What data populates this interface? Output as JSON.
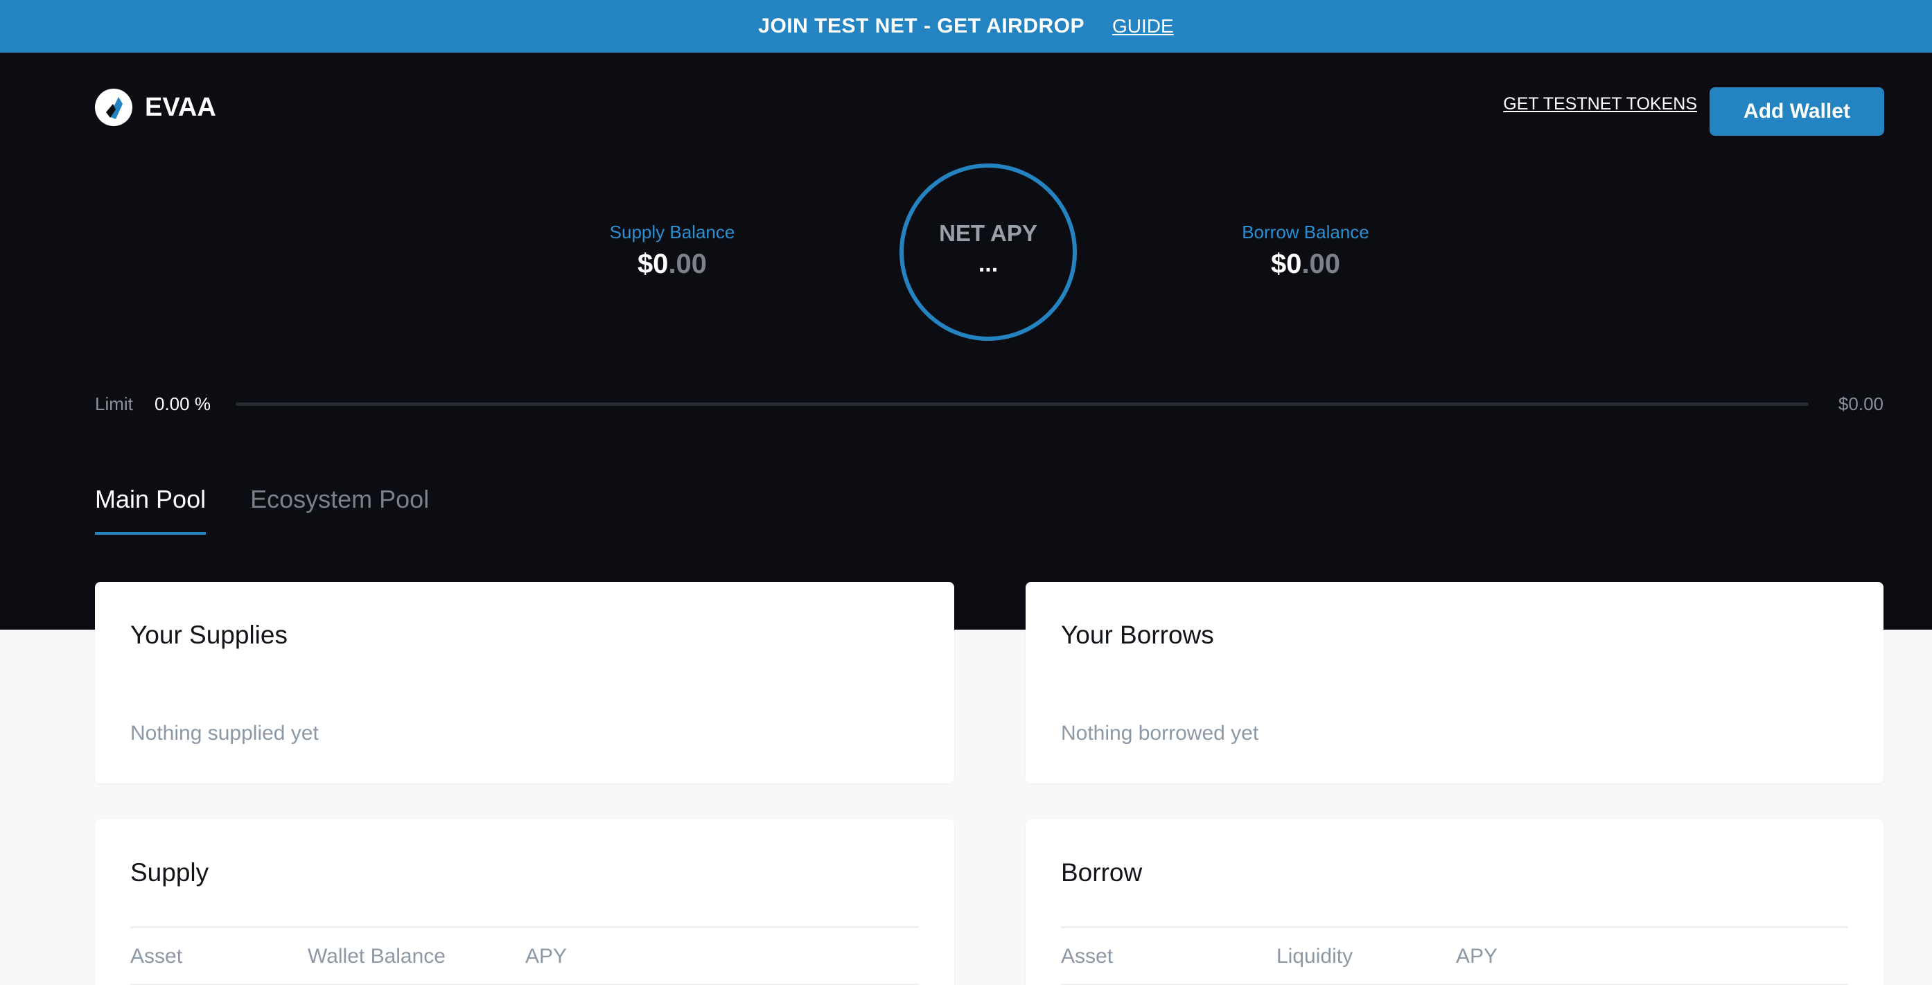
{
  "banner": {
    "title": "JOIN TEST NET - GET AIRDROP",
    "link": "GUIDE"
  },
  "header": {
    "logo_text": "EVAA",
    "testnet_link": "GET TESTNET TOKENS",
    "add_wallet": "Add Wallet"
  },
  "summary": {
    "supply_label": "Supply Balance",
    "supply_whole": "$0",
    "supply_cents": ".00",
    "net_apy_label": "NET APY",
    "net_apy_value": "...",
    "borrow_label": "Borrow Balance",
    "borrow_whole": "$0",
    "borrow_cents": ".00"
  },
  "limit": {
    "label": "Limit",
    "percent": "0.00 %",
    "progress": 0,
    "amount": "$0.00"
  },
  "tabs": [
    {
      "label": "Main Pool",
      "active": true
    },
    {
      "label": "Ecosystem Pool",
      "active": false
    }
  ],
  "your_supplies": {
    "title": "Your Supplies",
    "empty": "Nothing supplied yet"
  },
  "your_borrows": {
    "title": "Your Borrows",
    "empty": "Nothing borrowed yet"
  },
  "supply_table": {
    "title": "Supply",
    "columns": [
      "Asset",
      "Wallet Balance",
      "APY"
    ]
  },
  "borrow_table": {
    "title": "Borrow",
    "columns": [
      "Asset",
      "Liquidity",
      "APY"
    ]
  },
  "colors": {
    "accent": "#2483c1",
    "dark_bg": "#0b0d12",
    "page_bg": "#f7f8fa",
    "muted": "#8c98a4"
  }
}
